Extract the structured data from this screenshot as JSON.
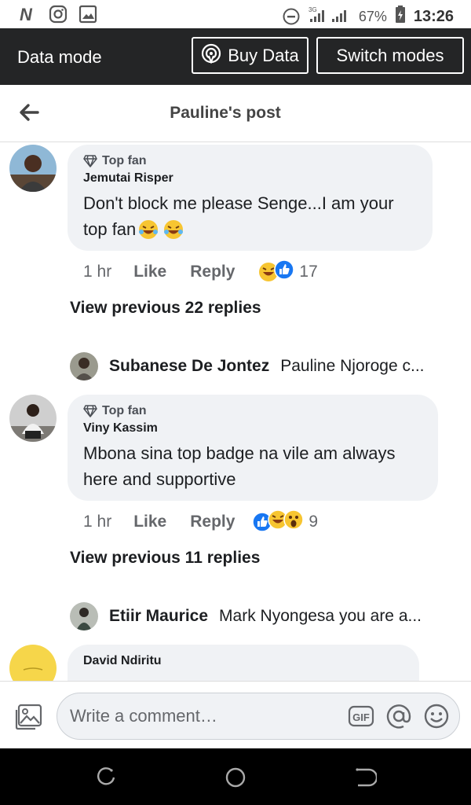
{
  "status_bar": {
    "battery": "67%",
    "time": "13:26"
  },
  "data_mode": {
    "title": "Data mode",
    "buy_label": "Buy Data",
    "switch_label": "Switch modes"
  },
  "header": {
    "title": "Pauline's post"
  },
  "comments": [
    {
      "badge": "Top fan",
      "author": "Jemutai Risper",
      "text_line1": "Don't block me please Senge...I am your",
      "text_line2": "top fan",
      "time": "1 hr",
      "like": "Like",
      "reply": "Reply",
      "reactions_count": "17",
      "view_previous": "View previous 22 replies",
      "reply_author": "Subanese De Jontez",
      "reply_snippet": "Pauline Njoroge c..."
    },
    {
      "badge": "Top fan",
      "author": "Viny Kassim",
      "text_line1": "Mbona sina top badge na vile am always",
      "text_line2": "here and supportive",
      "time": "1 hr",
      "like": "Like",
      "reply": "Reply",
      "reactions_count": "9",
      "view_previous": "View previous 11 replies",
      "reply_author": "Etiir Maurice",
      "reply_snippet": "Mark Nyongesa you are a..."
    },
    {
      "author": "David Ndiritu"
    }
  ],
  "composer": {
    "placeholder": "Write a comment…",
    "gif": "GIF"
  }
}
